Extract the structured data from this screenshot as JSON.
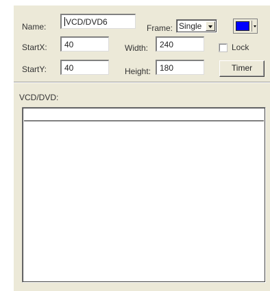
{
  "form": {
    "name_label": "Name:",
    "name_value": "VCD/DVD6",
    "frame_label": "Frame:",
    "frame_value": "Single",
    "frame_color": "#0000ff",
    "startx_label": "StartX:",
    "startx_value": "40",
    "width_label": "Width:",
    "width_value": "240",
    "lock_label": "Lock",
    "lock_checked": false,
    "starty_label": "StartY:",
    "starty_value": "40",
    "height_label": "Height:",
    "height_value": "180",
    "timer_label": "Timer"
  },
  "media": {
    "section_label": "VCD/DVD:"
  }
}
